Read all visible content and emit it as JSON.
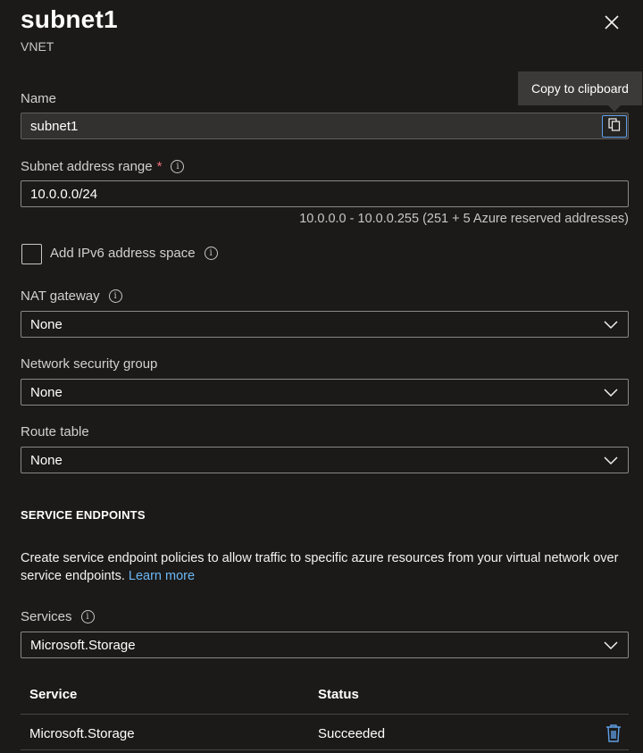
{
  "header": {
    "title": "subnet1",
    "subtitle": "VNET"
  },
  "tooltip": {
    "text": "Copy to clipboard"
  },
  "name": {
    "label": "Name",
    "value": "subnet1"
  },
  "address": {
    "label": "Subnet address range",
    "required_mark": "*",
    "value": "10.0.0.0/24",
    "hint": "10.0.0.0 - 10.0.0.255 (251 + 5 Azure reserved addresses)"
  },
  "ipv6": {
    "label": "Add IPv6 address space",
    "checked": false
  },
  "nat": {
    "label": "NAT gateway",
    "value": "None"
  },
  "nsg": {
    "label": "Network security group",
    "value": "None"
  },
  "route": {
    "label": "Route table",
    "value": "None"
  },
  "service_endpoints": {
    "heading": "SERVICE ENDPOINTS",
    "description": "Create service endpoint policies to allow traffic to specific azure resources from your virtual network over service endpoints.",
    "link": "Learn more",
    "services_label": "Services",
    "services_value": "Microsoft.Storage",
    "table": {
      "columns": [
        "Service",
        "Status"
      ],
      "rows": [
        {
          "service": "Microsoft.Storage",
          "status": "Succeeded"
        }
      ]
    }
  },
  "icons": {
    "info": "i"
  },
  "colors": {
    "accent": "#5fa0e8",
    "link": "#6cb8f6",
    "required": "#f1707b",
    "background": "#1b1a19"
  }
}
